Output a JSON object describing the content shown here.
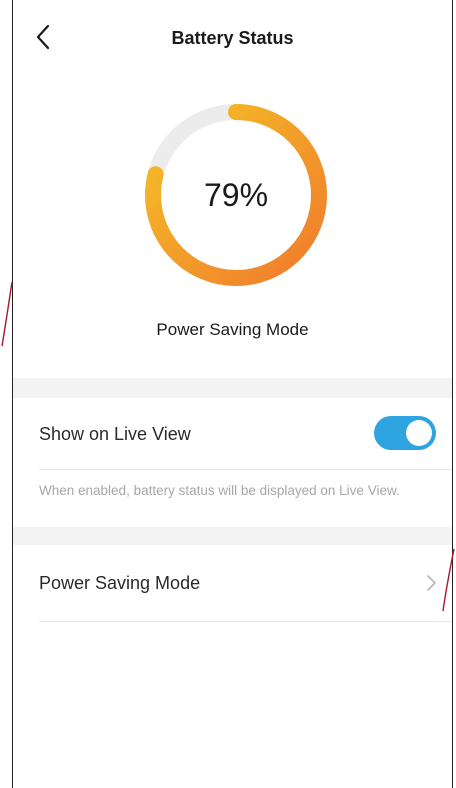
{
  "header": {
    "title": "Battery Status",
    "back_icon": "chevron-left-icon"
  },
  "battery": {
    "percent_label": "79%",
    "level": 0.79,
    "mode_label": "Power Saving Mode",
    "ring_colors": {
      "start": "#f07a2c",
      "end": "#f5c227",
      "track": "#ececec"
    }
  },
  "live_view": {
    "label": "Show on Live View",
    "enabled": true,
    "toggle_color": "#2ea4e0",
    "hint": "When enabled, battery status will be displayed on Live View."
  },
  "power_saving": {
    "label": "Power Saving Mode",
    "chevron_icon": "chevron-right-icon"
  }
}
